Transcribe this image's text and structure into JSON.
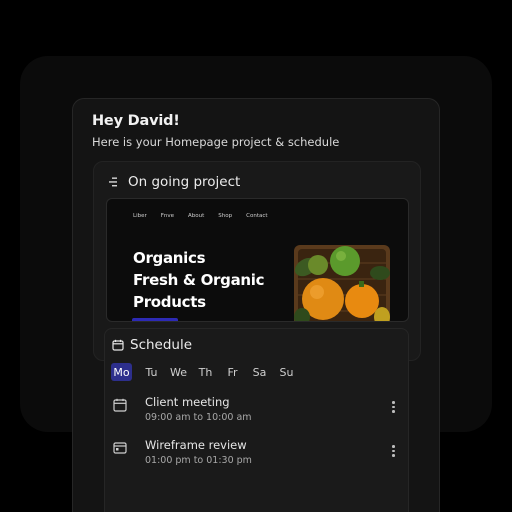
{
  "greeting": {
    "title": "Hey David!",
    "subtitle": "Here is your Homepage project & schedule"
  },
  "project": {
    "heading": "On going project",
    "icon": "list-icon",
    "preview": {
      "nav": [
        "Liber",
        "Fnve",
        "About",
        "Shop",
        "Contact"
      ],
      "hero_lines": [
        "Organics",
        "Fresh & Organic",
        "Products"
      ],
      "accent": "#2d2ab5"
    }
  },
  "schedule": {
    "heading": "Schedule",
    "icon": "calendar-icon",
    "days": [
      "Mo",
      "Tu",
      "We",
      "Th",
      "Fr",
      "Sa",
      "Su"
    ],
    "selected_day": "Mo",
    "selected_color": "#2d2f8c",
    "events": [
      {
        "title": "Client meeting",
        "time": "09:00 am to 10:00 am",
        "icon": "calendar-icon"
      },
      {
        "title": "Wireframe review",
        "time": "01:00 pm to 01:30 pm",
        "icon": "browser-window-icon"
      }
    ]
  }
}
